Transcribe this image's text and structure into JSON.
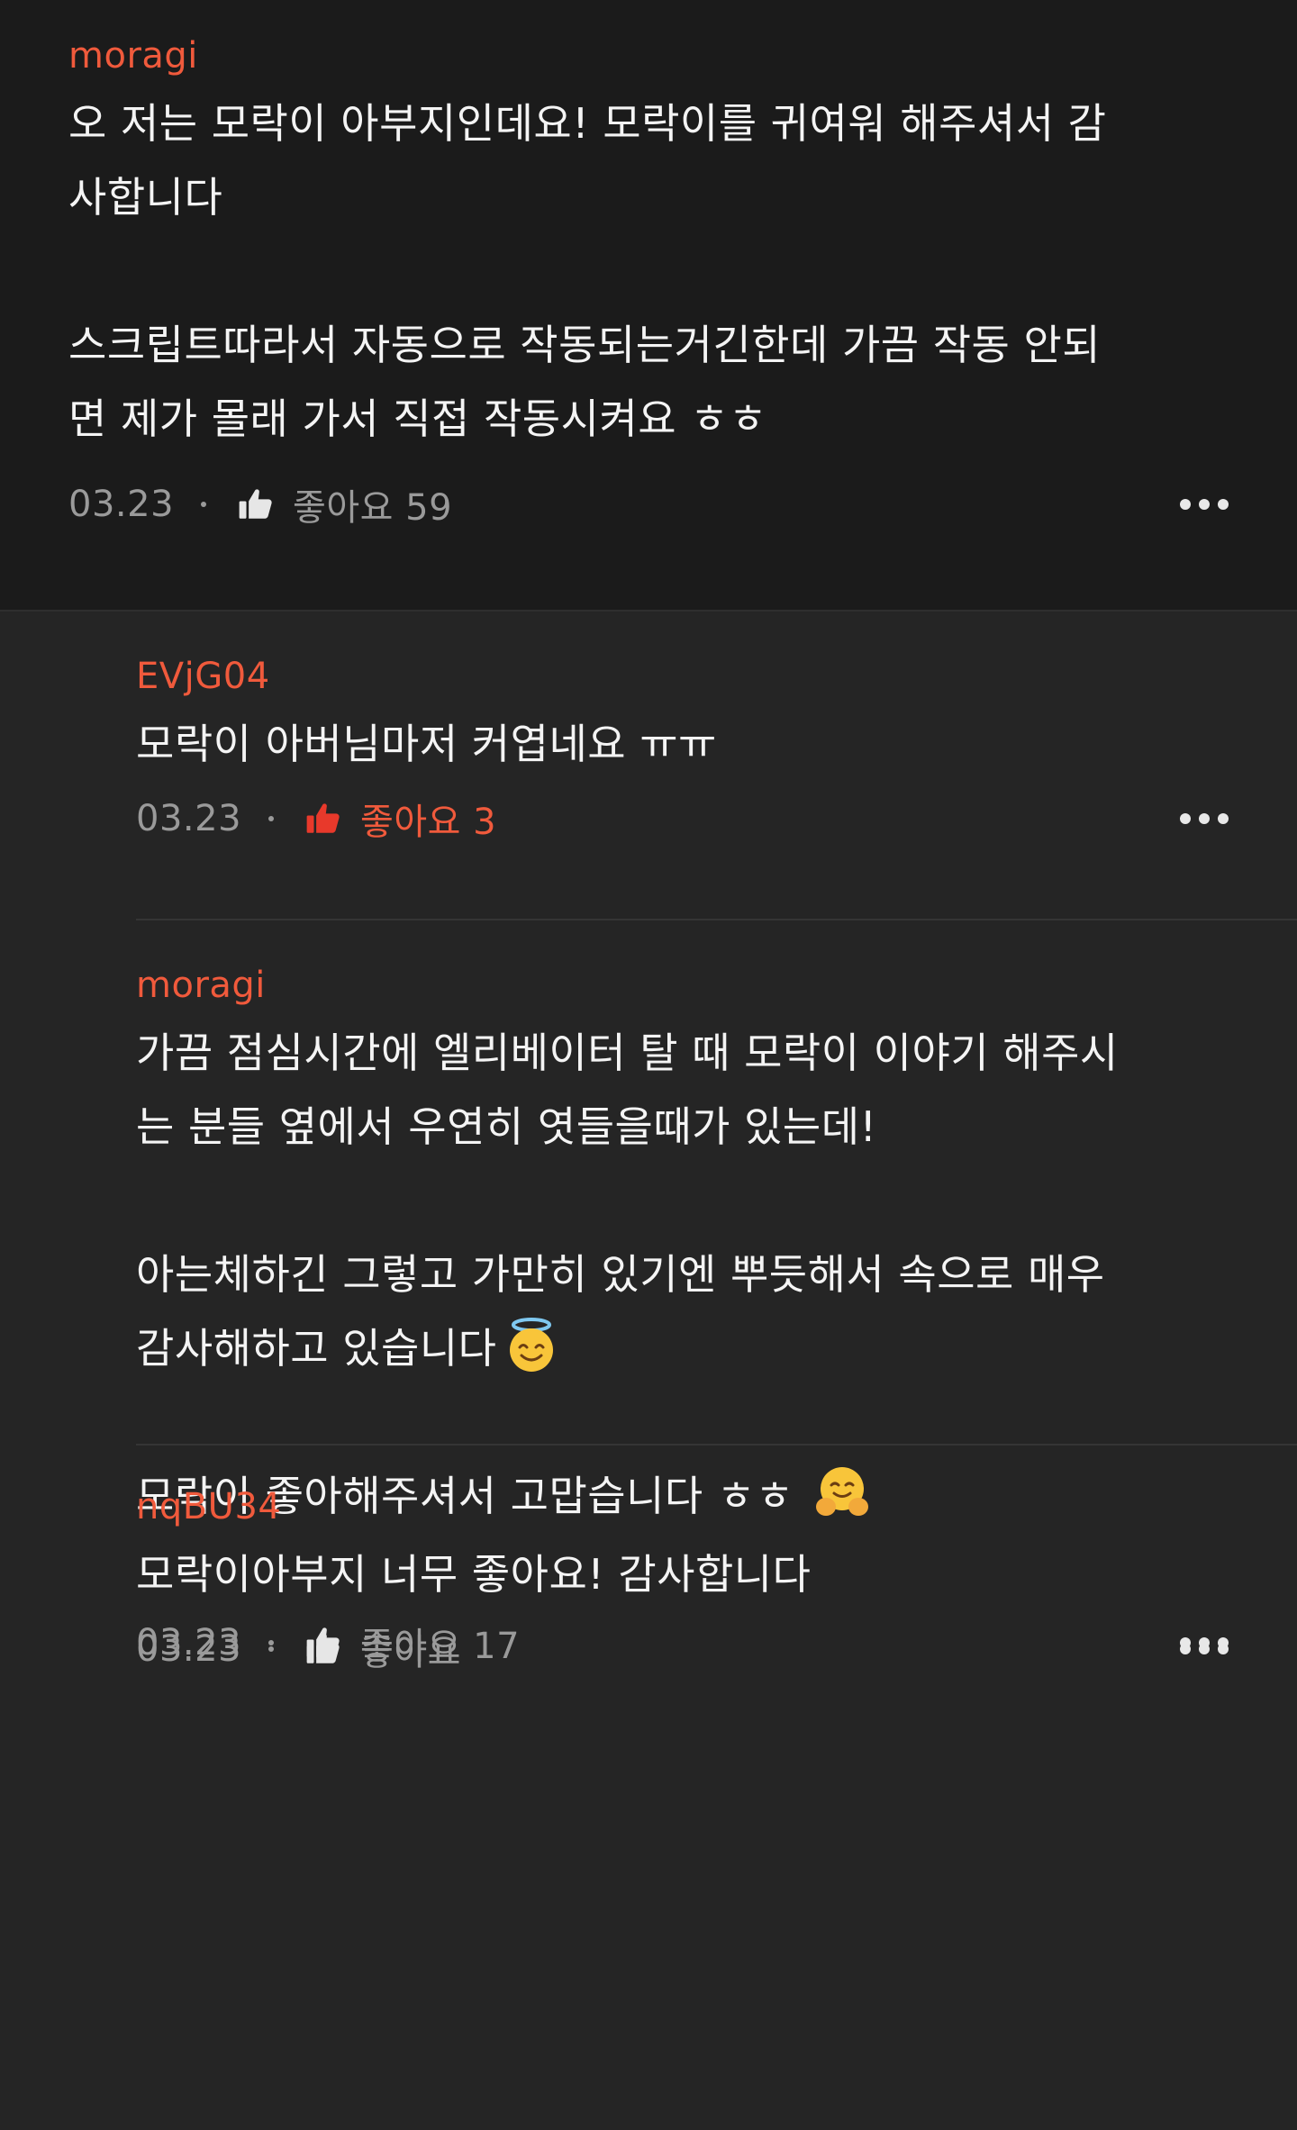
{
  "comments": {
    "top": {
      "author": "moragi",
      "text": "오 저는 모락이 아부지인데요! 모락이를 귀여워 해주셔서 감\n사합니다\n\n스크립트따라서 자동으로 작동되는거긴한데 가끔 작동 안되\n면 제가 몰래 가서 직접 작동시켜요 ㅎㅎ",
      "date": "03.23",
      "likes": "좋아요 59",
      "liked": false
    },
    "replies": [
      {
        "author": "EVjG04",
        "text": "모락이 아버님마저 커엽네요 ㅠㅠ",
        "date": "03.23",
        "likes": "좋아요 3",
        "liked": true
      },
      {
        "author": "moragi",
        "text_a": "가끔 점심시간에 엘리베이터 탈 때 모락이 이야기 해주시\n는 분들 옆에서 우연히 엿들을때가 있는데!\n\n아는체하긴 그렇고 가만히 있기엔 뿌듯해서 속으로 매우\n감사해하고 있습니다",
        "text_b": "모락이 좋아해주셔서 고맙습니다 ㅎㅎ",
        "emoji_a": "smiling-face-with-halo",
        "emoji_b": "hugging-face",
        "date": "03.23",
        "likes": "좋아요 17",
        "liked": false
      },
      {
        "author": "nqBU34",
        "text": "모락이아부지 너무 좋아요! 감사합니다",
        "date": "03.23",
        "likes": "좋아요",
        "liked": false
      }
    ]
  },
  "colors": {
    "author": "#f05a3c",
    "liked": "#e8392b",
    "meta": "#9a9a9a",
    "top_bg": "#1b1b1b",
    "reply_bg": "#252525"
  }
}
